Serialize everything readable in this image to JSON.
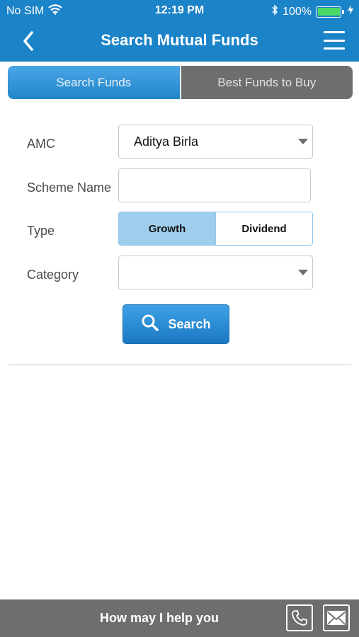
{
  "status_bar": {
    "carrier": "No SIM",
    "time": "12:19 PM",
    "battery": "100%",
    "battery_level": 1.0,
    "icons": [
      "wifi-icon",
      "bluetooth-icon",
      "battery-icon",
      "charging-icon"
    ]
  },
  "nav": {
    "title": "Search Mutual Funds",
    "back_icon": "chevron-left-icon",
    "menu_icon": "hamburger-menu-icon"
  },
  "tabs": [
    {
      "label": "Search Funds",
      "active": true
    },
    {
      "label": "Best Funds to Buy",
      "active": false
    }
  ],
  "form": {
    "amc": {
      "label": "AMC",
      "value": "Aditya Birla"
    },
    "scheme_name": {
      "label": "Scheme Name",
      "value": ""
    },
    "type": {
      "label": "Type",
      "options": [
        "Growth",
        "Dividend"
      ],
      "selected": "Growth"
    },
    "category": {
      "label": "Category",
      "value": ""
    },
    "search_button": {
      "label": "Search",
      "icon": "search-icon"
    }
  },
  "bottom_bar": {
    "help_text": "How may I help you",
    "icons": [
      "phone-icon",
      "mail-icon"
    ]
  },
  "colors": {
    "primary": "#1b83c8",
    "tab_inactive": "#6d6e70",
    "toggle_selected": "#9fcdee",
    "bottom_bar": "#6e6e70"
  }
}
